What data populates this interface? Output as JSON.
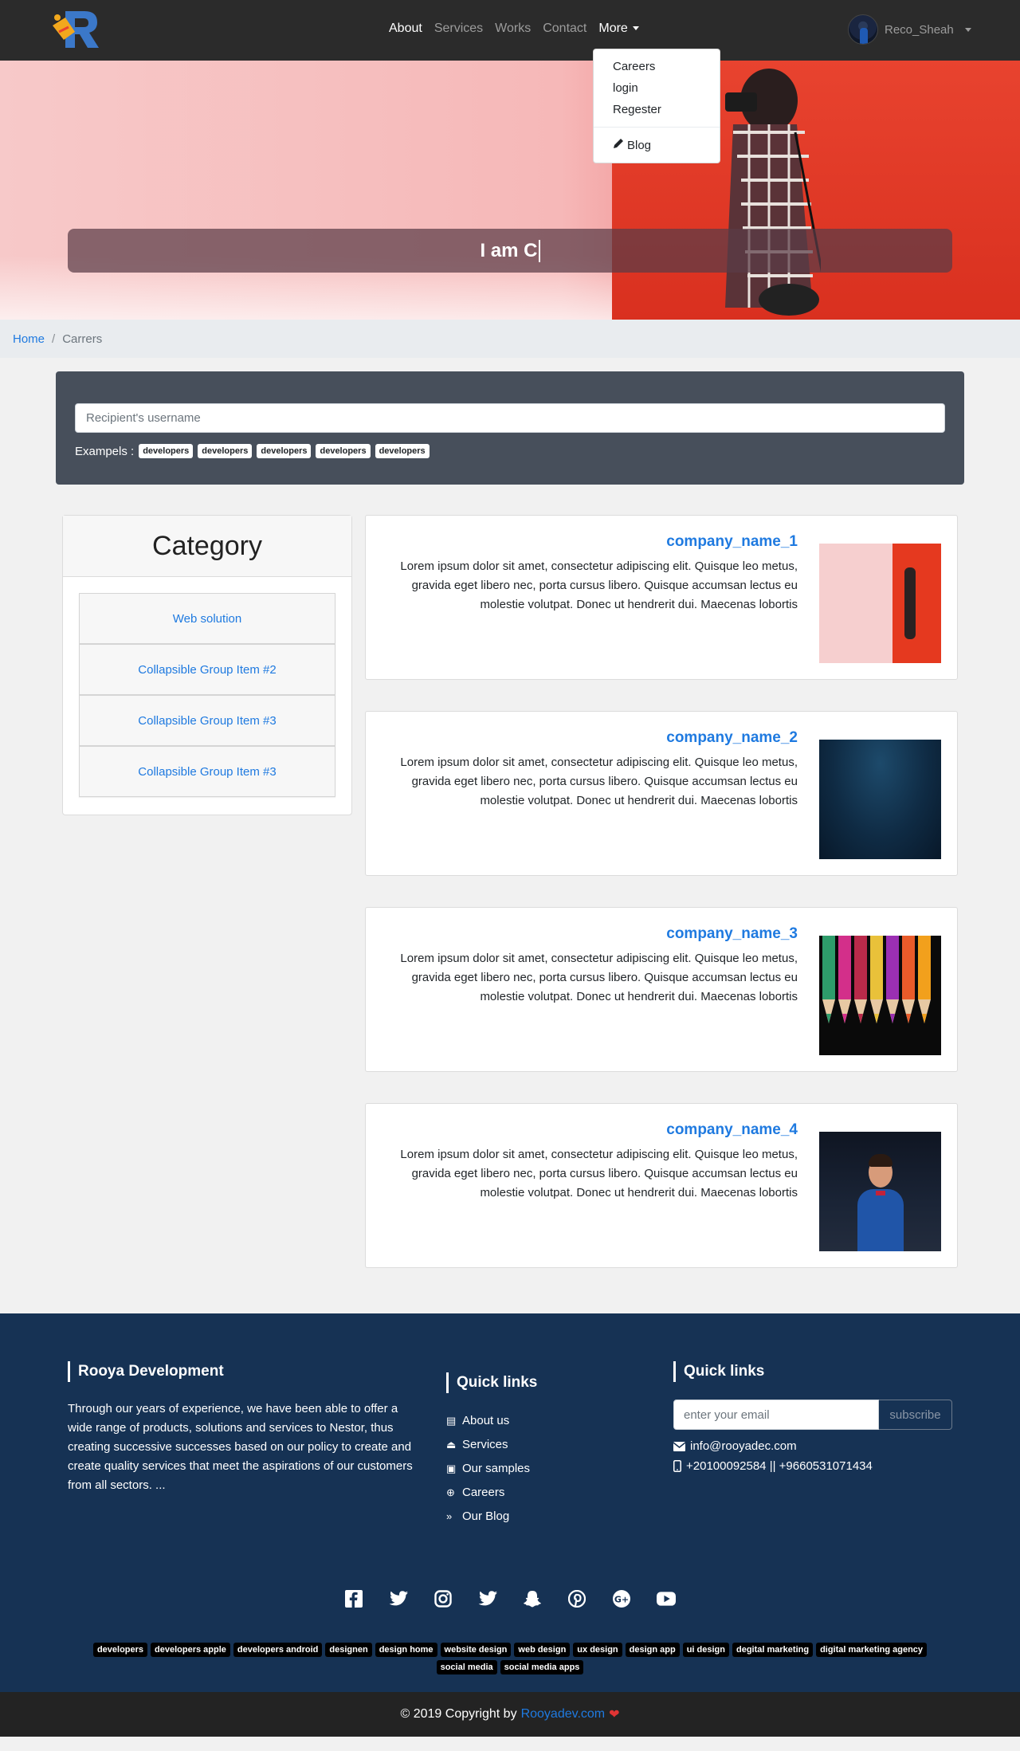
{
  "nav": {
    "links": [
      "About",
      "Services",
      "Works",
      "Contact"
    ],
    "more_label": "More",
    "user_name": "Reco_Sheah"
  },
  "dropdown": {
    "items": [
      "Careers",
      "login",
      "Regester"
    ],
    "blog_label": "Blog"
  },
  "hero": {
    "typed_text": "I am C"
  },
  "breadcrumb": {
    "home": "Home",
    "separator": "/",
    "current": "Carrers"
  },
  "search": {
    "placeholder": "Recipient's username",
    "examples_label": "Exampels :",
    "examples": [
      "developers",
      "developers",
      "developers",
      "developers",
      "developers"
    ]
  },
  "category": {
    "title": "Category",
    "items": [
      "Web solution",
      "Collapsible Group Item #2",
      "Collapsible Group Item #3",
      "Collapsible Group Item #3"
    ]
  },
  "companies": [
    {
      "name": "company_name_1",
      "description": "Lorem ipsum dolor sit amet, consectetur adipiscing elit. Quisque leo metus, gravida eget libero nec, porta cursus libero. Quisque accumsan lectus eu molestie volutpat. Donec ut hendrerit dui. Maecenas lobortis"
    },
    {
      "name": "company_name_2",
      "description": "Lorem ipsum dolor sit amet, consectetur adipiscing elit. Quisque leo metus, gravida eget libero nec, porta cursus libero. Quisque accumsan lectus eu molestie volutpat. Donec ut hendrerit dui. Maecenas lobortis"
    },
    {
      "name": "company_name_3",
      "description": "Lorem ipsum dolor sit amet, consectetur adipiscing elit. Quisque leo metus, gravida eget libero nec, porta cursus libero. Quisque accumsan lectus eu molestie volutpat. Donec ut hendrerit dui. Maecenas lobortis"
    },
    {
      "name": "company_name_4",
      "description": "Lorem ipsum dolor sit amet, consectetur adipiscing elit. Quisque leo metus, gravida eget libero nec, porta cursus libero. Quisque accumsan lectus eu molestie volutpat. Donec ut hendrerit dui. Maecenas lobortis"
    }
  ],
  "footer": {
    "about_title": "Rooya Development",
    "about_text": "Through our years of experience, we have been able to offer a wide range of products, solutions and services to Nestor, thus creating successive successes based on our policy to create and create quality services that meet the aspirations of our customers from all sectors. ...",
    "links_title": "Quick links",
    "links": [
      "About us",
      "Services",
      "Our samples",
      "Careers",
      "Our Blog"
    ],
    "contact_title": "Quick links",
    "email_placeholder": "enter your email",
    "subscribe_label": "subscribe",
    "email": "info@rooyadec.com",
    "phones": "+20100092584 || +9660531071434",
    "socials": [
      "facebook-icon",
      "twitter-icon",
      "instagram-icon",
      "twitter-icon",
      "snapchat-icon",
      "pinterest-icon",
      "google-plus-icon",
      "youtube-icon"
    ],
    "tags": [
      "developers",
      "developers apple",
      "developers android",
      "designen",
      "design home",
      "website design",
      "web design",
      "ux design",
      "design app",
      "ui design",
      "degital marketing",
      "digital marketing agency",
      "social media",
      "social media apps"
    ]
  },
  "copyright": {
    "text": "© 2019 Copyright by",
    "site": "Rooyadev.com"
  },
  "colors": {
    "accent": "#1f7ae0",
    "navbar": "#2b2b2b",
    "footer": "#163254",
    "search_block": "#474f5b"
  }
}
